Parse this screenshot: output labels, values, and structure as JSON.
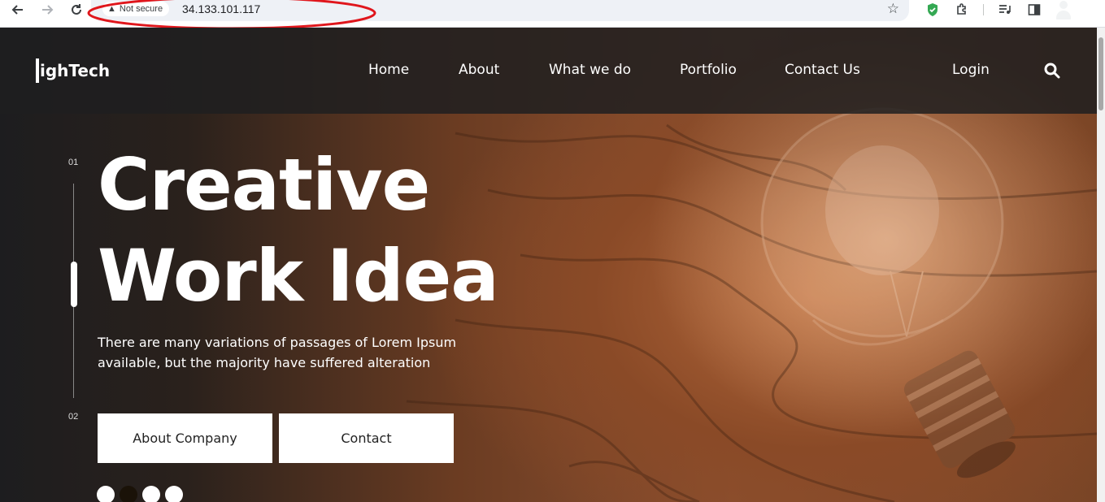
{
  "browser": {
    "security_label": "Not secure",
    "url": "34.133.101.117",
    "icons": [
      "back-icon",
      "forward-icon",
      "reload-icon",
      "warning-icon",
      "star-icon",
      "shield-extension-icon",
      "extensions-icon",
      "media-icon",
      "sidebar-icon",
      "profile-icon"
    ]
  },
  "site": {
    "logo": "HighTech",
    "logo_rest": "ighTech",
    "nav": {
      "home": "Home",
      "about": "About",
      "what_we_do": "What we do",
      "portfolio": "Portfolio",
      "contact_us": "Contact Us",
      "login": "Login"
    }
  },
  "hero": {
    "slide_first": "01",
    "slide_last": "02",
    "title_line1": "Creative",
    "title_line2": "Work Idea",
    "subtitle_line1": "There are many variations of passages of Lorem Ipsum",
    "subtitle_line2": "available, but the majority have suffered alteration",
    "button_about": "About Company",
    "button_contact": "Contact",
    "dots": [
      false,
      true,
      false,
      false
    ]
  },
  "colors": {
    "annotation": "#e0161c",
    "header_bg": "#1e1e20",
    "active_dot": "#1a1208"
  }
}
